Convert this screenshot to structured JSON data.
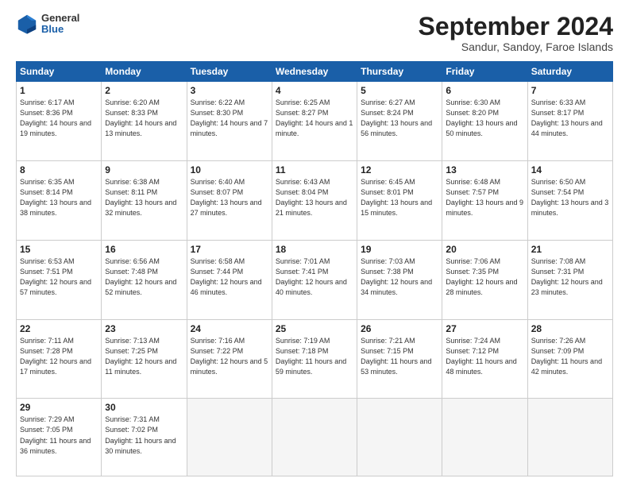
{
  "logo": {
    "general": "General",
    "blue": "Blue"
  },
  "title": "September 2024",
  "subtitle": "Sandur, Sandoy, Faroe Islands",
  "weekdays": [
    "Sunday",
    "Monday",
    "Tuesday",
    "Wednesday",
    "Thursday",
    "Friday",
    "Saturday"
  ],
  "weeks": [
    [
      {
        "day": "1",
        "info": "Sunrise: 6:17 AM\nSunset: 8:36 PM\nDaylight: 14 hours\nand 19 minutes."
      },
      {
        "day": "2",
        "info": "Sunrise: 6:20 AM\nSunset: 8:33 PM\nDaylight: 14 hours\nand 13 minutes."
      },
      {
        "day": "3",
        "info": "Sunrise: 6:22 AM\nSunset: 8:30 PM\nDaylight: 14 hours\nand 7 minutes."
      },
      {
        "day": "4",
        "info": "Sunrise: 6:25 AM\nSunset: 8:27 PM\nDaylight: 14 hours\nand 1 minute."
      },
      {
        "day": "5",
        "info": "Sunrise: 6:27 AM\nSunset: 8:24 PM\nDaylight: 13 hours\nand 56 minutes."
      },
      {
        "day": "6",
        "info": "Sunrise: 6:30 AM\nSunset: 8:20 PM\nDaylight: 13 hours\nand 50 minutes."
      },
      {
        "day": "7",
        "info": "Sunrise: 6:33 AM\nSunset: 8:17 PM\nDaylight: 13 hours\nand 44 minutes."
      }
    ],
    [
      {
        "day": "8",
        "info": "Sunrise: 6:35 AM\nSunset: 8:14 PM\nDaylight: 13 hours\nand 38 minutes."
      },
      {
        "day": "9",
        "info": "Sunrise: 6:38 AM\nSunset: 8:11 PM\nDaylight: 13 hours\nand 32 minutes."
      },
      {
        "day": "10",
        "info": "Sunrise: 6:40 AM\nSunset: 8:07 PM\nDaylight: 13 hours\nand 27 minutes."
      },
      {
        "day": "11",
        "info": "Sunrise: 6:43 AM\nSunset: 8:04 PM\nDaylight: 13 hours\nand 21 minutes."
      },
      {
        "day": "12",
        "info": "Sunrise: 6:45 AM\nSunset: 8:01 PM\nDaylight: 13 hours\nand 15 minutes."
      },
      {
        "day": "13",
        "info": "Sunrise: 6:48 AM\nSunset: 7:57 PM\nDaylight: 13 hours\nand 9 minutes."
      },
      {
        "day": "14",
        "info": "Sunrise: 6:50 AM\nSunset: 7:54 PM\nDaylight: 13 hours\nand 3 minutes."
      }
    ],
    [
      {
        "day": "15",
        "info": "Sunrise: 6:53 AM\nSunset: 7:51 PM\nDaylight: 12 hours\nand 57 minutes."
      },
      {
        "day": "16",
        "info": "Sunrise: 6:56 AM\nSunset: 7:48 PM\nDaylight: 12 hours\nand 52 minutes."
      },
      {
        "day": "17",
        "info": "Sunrise: 6:58 AM\nSunset: 7:44 PM\nDaylight: 12 hours\nand 46 minutes."
      },
      {
        "day": "18",
        "info": "Sunrise: 7:01 AM\nSunset: 7:41 PM\nDaylight: 12 hours\nand 40 minutes."
      },
      {
        "day": "19",
        "info": "Sunrise: 7:03 AM\nSunset: 7:38 PM\nDaylight: 12 hours\nand 34 minutes."
      },
      {
        "day": "20",
        "info": "Sunrise: 7:06 AM\nSunset: 7:35 PM\nDaylight: 12 hours\nand 28 minutes."
      },
      {
        "day": "21",
        "info": "Sunrise: 7:08 AM\nSunset: 7:31 PM\nDaylight: 12 hours\nand 23 minutes."
      }
    ],
    [
      {
        "day": "22",
        "info": "Sunrise: 7:11 AM\nSunset: 7:28 PM\nDaylight: 12 hours\nand 17 minutes."
      },
      {
        "day": "23",
        "info": "Sunrise: 7:13 AM\nSunset: 7:25 PM\nDaylight: 12 hours\nand 11 minutes."
      },
      {
        "day": "24",
        "info": "Sunrise: 7:16 AM\nSunset: 7:22 PM\nDaylight: 12 hours\nand 5 minutes."
      },
      {
        "day": "25",
        "info": "Sunrise: 7:19 AM\nSunset: 7:18 PM\nDaylight: 11 hours\nand 59 minutes."
      },
      {
        "day": "26",
        "info": "Sunrise: 7:21 AM\nSunset: 7:15 PM\nDaylight: 11 hours\nand 53 minutes."
      },
      {
        "day": "27",
        "info": "Sunrise: 7:24 AM\nSunset: 7:12 PM\nDaylight: 11 hours\nand 48 minutes."
      },
      {
        "day": "28",
        "info": "Sunrise: 7:26 AM\nSunset: 7:09 PM\nDaylight: 11 hours\nand 42 minutes."
      }
    ],
    [
      {
        "day": "29",
        "info": "Sunrise: 7:29 AM\nSunset: 7:05 PM\nDaylight: 11 hours\nand 36 minutes."
      },
      {
        "day": "30",
        "info": "Sunrise: 7:31 AM\nSunset: 7:02 PM\nDaylight: 11 hours\nand 30 minutes."
      },
      {
        "day": "",
        "info": ""
      },
      {
        "day": "",
        "info": ""
      },
      {
        "day": "",
        "info": ""
      },
      {
        "day": "",
        "info": ""
      },
      {
        "day": "",
        "info": ""
      }
    ]
  ]
}
